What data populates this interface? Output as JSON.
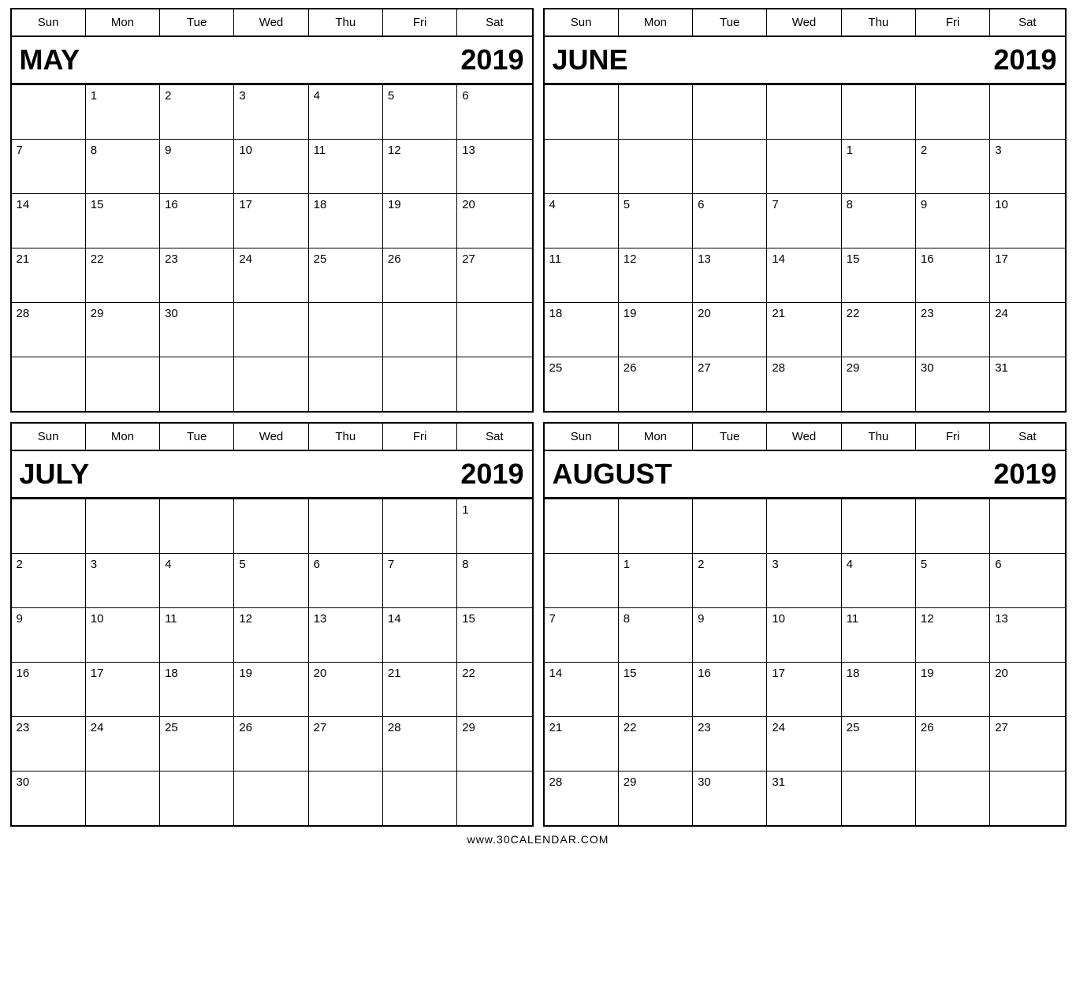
{
  "footer": "www.30CALENDAR.COM",
  "dayNames": [
    "Sun",
    "Mon",
    "Tue",
    "Wed",
    "Thu",
    "Fri",
    "Sat"
  ],
  "calendars": [
    {
      "id": "may-2019",
      "month": "MAY",
      "year": "2019",
      "weeks": [
        [
          "",
          "1",
          "2",
          "3",
          "4",
          "5",
          "6"
        ],
        [
          "7",
          "8",
          "9",
          "10",
          "11",
          "12",
          "13"
        ],
        [
          "14",
          "15",
          "16",
          "17",
          "18",
          "19",
          "20"
        ],
        [
          "21",
          "22",
          "23",
          "24",
          "25",
          "26",
          "27"
        ],
        [
          "28",
          "29",
          "30",
          "",
          "",
          "",
          ""
        ],
        [
          "",
          "",
          "",
          "",
          "",
          "",
          ""
        ]
      ]
    },
    {
      "id": "june-2019",
      "month": "JUNE",
      "year": "2019",
      "weeks": [
        [
          "",
          "",
          "",
          "",
          "",
          "",
          ""
        ],
        [
          "",
          "",
          "",
          "",
          "1",
          "2",
          "3",
          "4"
        ],
        [
          "5",
          "6",
          "7",
          "8",
          "9",
          "10",
          "11"
        ],
        [
          "12",
          "13",
          "14",
          "15",
          "16",
          "17",
          "18"
        ],
        [
          "19",
          "20",
          "21",
          "22",
          "23",
          "24",
          "25"
        ],
        [
          "26",
          "27",
          "28",
          "29",
          "30",
          "31",
          ""
        ]
      ]
    },
    {
      "id": "july-2019",
      "month": "JULY",
      "year": "2019",
      "weeks": [
        [
          "",
          "",
          "",
          "",
          "",
          "",
          "1"
        ],
        [
          "2",
          "3",
          "4",
          "5",
          "6",
          "7",
          "8"
        ],
        [
          "9",
          "10",
          "11",
          "12",
          "13",
          "14",
          "15"
        ],
        [
          "16",
          "17",
          "18",
          "19",
          "20",
          "21",
          "22"
        ],
        [
          "23",
          "24",
          "25",
          "26",
          "27",
          "28",
          "29"
        ],
        [
          "30",
          "",
          "",
          "",
          "",
          "",
          ""
        ]
      ]
    },
    {
      "id": "august-2019",
      "month": "AUGUST",
      "year": "2019",
      "weeks": [
        [
          "",
          "",
          "",
          "",
          "",
          "",
          ""
        ],
        [
          "",
          "1",
          "2",
          "3",
          "4",
          "5",
          "6"
        ],
        [
          "7",
          "8",
          "9",
          "10",
          "11",
          "12",
          "13"
        ],
        [
          "14",
          "15",
          "16",
          "17",
          "18",
          "19",
          "20"
        ],
        [
          "21",
          "22",
          "23",
          "24",
          "25",
          "26",
          "27"
        ],
        [
          "28",
          "29",
          "30",
          "31",
          "",
          "",
          ""
        ]
      ]
    }
  ]
}
